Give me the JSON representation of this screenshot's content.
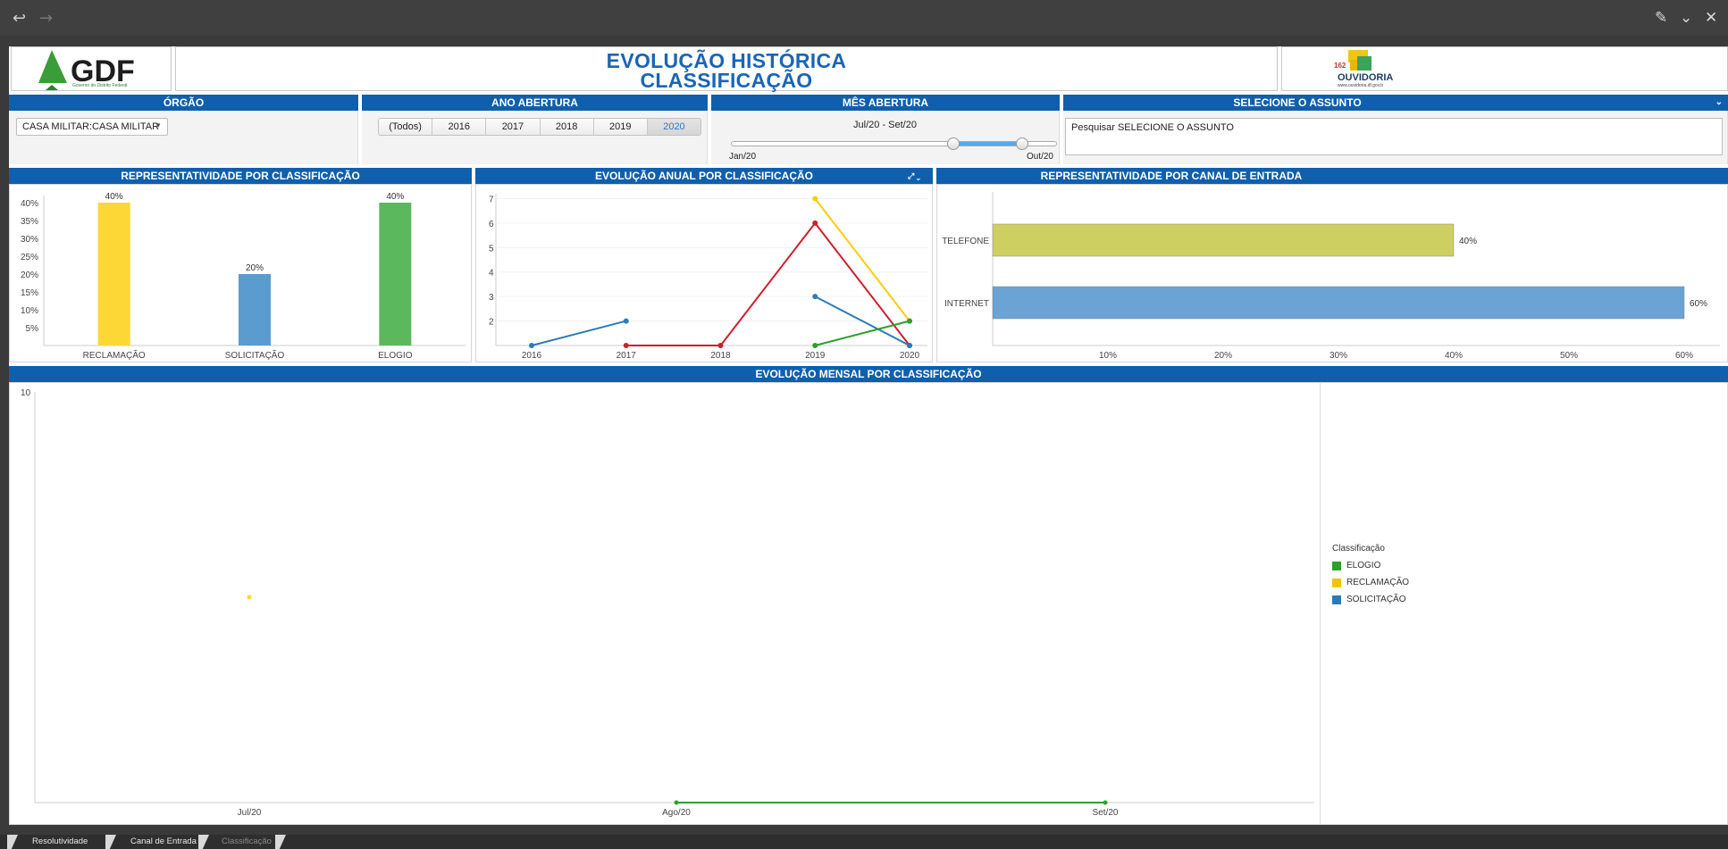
{
  "window": {
    "back_icon": "back-arrow-icon",
    "forward_icon": "forward-arrow-icon"
  },
  "header": {
    "logo_text": "GDF",
    "logo_subtext": "Governo do Distrito Federal",
    "title_line1": "EVOLUÇÃO HISTÓRICA",
    "title_line2": "CLASSIFICAÇÃO",
    "ouvidoria_text": "OUVIDORIA",
    "ouvidoria_phone": "162",
    "ouvidoria_url": "www.ouvidoria.df.gov.b"
  },
  "filters": {
    "orgao": {
      "title": "ÓRGÃO",
      "value": "CASA MILITAR:CASA MILITAR"
    },
    "ano": {
      "title": "ANO ABERTURA",
      "options": [
        "(Todos)",
        "2016",
        "2017",
        "2018",
        "2019",
        "2020"
      ],
      "selected": "2020"
    },
    "mes": {
      "title": "MÊS ABERTURA",
      "range_label": "Jul/20 - Set/20",
      "min_label": "Jan/20",
      "max_label": "Out/20",
      "range_start": 0.68,
      "range_end": 0.89
    },
    "assunto": {
      "title": "SELECIONE O ASSUNTO",
      "placeholder": "Pesquisar SELECIONE O ASSUNTO"
    }
  },
  "panels": {
    "representatividade_title": "REPRESENTATIVIDADE POR CLASSIFICAÇÃO",
    "evolucao_anual_title": "EVOLUÇÃO ANUAL POR CLASSIFICAÇÃO",
    "canal_title": "REPRESENTATIVIDADE POR CANAL DE ENTRADA",
    "mensal_title": "EVOLUÇÃO MENSAL POR CLASSIFICAÇÃO"
  },
  "colors": {
    "elogio": "#5cb85c",
    "reclamacao": "#fdd835",
    "solicitacao": "#5a9bd0",
    "reclamacao_line": "#cc1f2e",
    "solicitacao_line": "#2b7bb9",
    "elogio_line": "#2ca02c",
    "reclamacao_line2": "#f9cc10",
    "telefone": "#cdd060",
    "internet": "#6aa3d4"
  },
  "chart_data": [
    {
      "type": "bar",
      "categories": [
        "RECLAMAÇÃO",
        "SOLICITAÇÃO",
        "ELOGIO"
      ],
      "values": [
        40,
        20,
        40
      ],
      "labels": [
        "40%",
        "20%",
        "40%"
      ],
      "yticks": [
        "5%",
        "10%",
        "15%",
        "20%",
        "25%",
        "30%",
        "35%",
        "40%"
      ],
      "ylim": [
        0,
        42
      ]
    },
    {
      "type": "line",
      "x": [
        "2016",
        "2017",
        "2018",
        "2019",
        "2020"
      ],
      "yticks": [
        "2",
        "3",
        "4",
        "5",
        "6",
        "7"
      ],
      "ylim": [
        1,
        7.2
      ],
      "series": [
        {
          "values": [
            1,
            2,
            null,
            null,
            null
          ]
        },
        {
          "values": [
            null,
            1,
            1,
            6,
            1
          ]
        },
        {
          "values": [
            null,
            null,
            null,
            7,
            2
          ]
        },
        {
          "values": [
            null,
            null,
            null,
            3,
            1
          ]
        },
        {
          "values": [
            null,
            null,
            null,
            1,
            2
          ]
        }
      ]
    },
    {
      "type": "bar",
      "orientation": "horizontal",
      "categories": [
        "TELEFONE",
        "INTERNET"
      ],
      "values": [
        40,
        60
      ],
      "labels": [
        "40%",
        "60%"
      ],
      "xticks": [
        "10%",
        "20%",
        "30%",
        "40%",
        "50%",
        "60%"
      ],
      "xlim": [
        0,
        60
      ]
    },
    {
      "type": "line",
      "x": [
        "Jul/20",
        "Ago/20",
        "Set/20"
      ],
      "yticks": [
        "10"
      ],
      "series": [
        {
          "name": "RECLAMAÇÃO",
          "values": [
            5,
            null,
            null
          ]
        },
        {
          "name": "ELOGIO",
          "values": [
            null,
            0,
            0
          ]
        }
      ],
      "legend_title": "Classificação",
      "legend": [
        "ELOGIO",
        "RECLAMAÇÃO",
        "SOLICITAÇÃO"
      ],
      "legend_position": "right"
    }
  ],
  "tabs": [
    "Resolutividade",
    "Canal de Entrada",
    "Classificação"
  ],
  "active_tab": "Classificação"
}
